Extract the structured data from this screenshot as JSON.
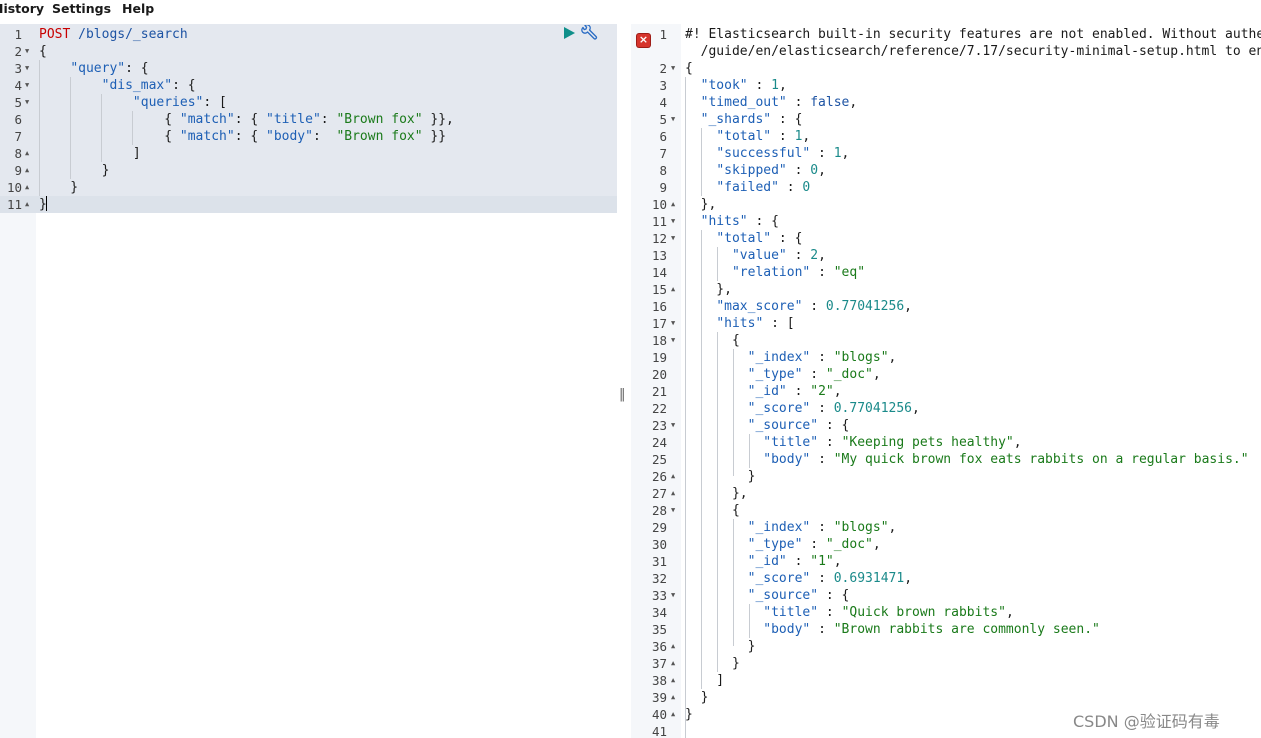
{
  "menu": {
    "history_label": "History",
    "settings_label": "Settings",
    "help_label": "Help"
  },
  "request_editor": {
    "lines": [
      {
        "n": "1",
        "fold": "",
        "tokens": [
          {
            "t": "POST",
            "c": "method"
          },
          {
            "t": " /blogs/_search",
            "c": "url"
          }
        ]
      },
      {
        "n": "2",
        "fold": "▼",
        "tokens": [
          {
            "t": "{",
            "c": "punc"
          }
        ]
      },
      {
        "n": "3",
        "fold": "▼",
        "tokens": [
          {
            "t": "    ",
            "c": "punc"
          },
          {
            "t": "\"query\"",
            "c": "key"
          },
          {
            "t": ": {",
            "c": "punc"
          }
        ]
      },
      {
        "n": "4",
        "fold": "▼",
        "tokens": [
          {
            "t": "        ",
            "c": "punc"
          },
          {
            "t": "\"dis_max\"",
            "c": "key"
          },
          {
            "t": ": {",
            "c": "punc"
          }
        ]
      },
      {
        "n": "5",
        "fold": "▼",
        "tokens": [
          {
            "t": "            ",
            "c": "punc"
          },
          {
            "t": "\"queries\"",
            "c": "key"
          },
          {
            "t": ": [",
            "c": "punc"
          }
        ]
      },
      {
        "n": "6",
        "fold": "",
        "tokens": [
          {
            "t": "                { ",
            "c": "punc"
          },
          {
            "t": "\"match\"",
            "c": "key"
          },
          {
            "t": ": { ",
            "c": "punc"
          },
          {
            "t": "\"title\"",
            "c": "key"
          },
          {
            "t": ": ",
            "c": "punc"
          },
          {
            "t": "\"Brown fox\"",
            "c": "str"
          },
          {
            "t": " }},",
            "c": "punc"
          }
        ]
      },
      {
        "n": "7",
        "fold": "",
        "tokens": [
          {
            "t": "                { ",
            "c": "punc"
          },
          {
            "t": "\"match\"",
            "c": "key"
          },
          {
            "t": ": { ",
            "c": "punc"
          },
          {
            "t": "\"body\"",
            "c": "key"
          },
          {
            "t": ":  ",
            "c": "punc"
          },
          {
            "t": "\"Brown fox\"",
            "c": "str"
          },
          {
            "t": " }}",
            "c": "punc"
          }
        ]
      },
      {
        "n": "8",
        "fold": "▲",
        "tokens": [
          {
            "t": "            ]",
            "c": "punc"
          }
        ]
      },
      {
        "n": "9",
        "fold": "▲",
        "tokens": [
          {
            "t": "        }",
            "c": "punc"
          }
        ]
      },
      {
        "n": "10",
        "fold": "▲",
        "tokens": [
          {
            "t": "    }",
            "c": "punc"
          }
        ]
      },
      {
        "n": "11",
        "fold": "▲",
        "tokens": [
          {
            "t": "}",
            "c": "punc"
          }
        ]
      }
    ]
  },
  "response_viewer": {
    "error_marker": "×",
    "lines": [
      {
        "n": "1",
        "fold": "",
        "tokens": [
          {
            "t": "#! Elasticsearch built-in security features are not enabled. Without authen",
            "c": "comment"
          }
        ]
      },
      {
        "n": "",
        "fold": "",
        "tokens": [
          {
            "t": "  /guide/en/elasticsearch/reference/7.17/security-minimal-setup.html to ena",
            "c": "comment"
          }
        ]
      },
      {
        "n": "2",
        "fold": "▼",
        "tokens": [
          {
            "t": "{",
            "c": "punc"
          }
        ]
      },
      {
        "n": "3",
        "fold": "",
        "tokens": [
          {
            "t": "  ",
            "c": "punc"
          },
          {
            "t": "\"took\"",
            "c": "key"
          },
          {
            "t": " : ",
            "c": "punc"
          },
          {
            "t": "1",
            "c": "num"
          },
          {
            "t": ",",
            "c": "punc"
          }
        ]
      },
      {
        "n": "4",
        "fold": "",
        "tokens": [
          {
            "t": "  ",
            "c": "punc"
          },
          {
            "t": "\"timed_out\"",
            "c": "key"
          },
          {
            "t": " : ",
            "c": "punc"
          },
          {
            "t": "false",
            "c": "bool"
          },
          {
            "t": ",",
            "c": "punc"
          }
        ]
      },
      {
        "n": "5",
        "fold": "▼",
        "tokens": [
          {
            "t": "  ",
            "c": "punc"
          },
          {
            "t": "\"_shards\"",
            "c": "key"
          },
          {
            "t": " : {",
            "c": "punc"
          }
        ]
      },
      {
        "n": "6",
        "fold": "",
        "tokens": [
          {
            "t": "    ",
            "c": "punc"
          },
          {
            "t": "\"total\"",
            "c": "key"
          },
          {
            "t": " : ",
            "c": "punc"
          },
          {
            "t": "1",
            "c": "num"
          },
          {
            "t": ",",
            "c": "punc"
          }
        ]
      },
      {
        "n": "7",
        "fold": "",
        "tokens": [
          {
            "t": "    ",
            "c": "punc"
          },
          {
            "t": "\"successful\"",
            "c": "key"
          },
          {
            "t": " : ",
            "c": "punc"
          },
          {
            "t": "1",
            "c": "num"
          },
          {
            "t": ",",
            "c": "punc"
          }
        ]
      },
      {
        "n": "8",
        "fold": "",
        "tokens": [
          {
            "t": "    ",
            "c": "punc"
          },
          {
            "t": "\"skipped\"",
            "c": "key"
          },
          {
            "t": " : ",
            "c": "punc"
          },
          {
            "t": "0",
            "c": "num"
          },
          {
            "t": ",",
            "c": "punc"
          }
        ]
      },
      {
        "n": "9",
        "fold": "",
        "tokens": [
          {
            "t": "    ",
            "c": "punc"
          },
          {
            "t": "\"failed\"",
            "c": "key"
          },
          {
            "t": " : ",
            "c": "punc"
          },
          {
            "t": "0",
            "c": "num"
          }
        ]
      },
      {
        "n": "10",
        "fold": "▲",
        "tokens": [
          {
            "t": "  },",
            "c": "punc"
          }
        ]
      },
      {
        "n": "11",
        "fold": "▼",
        "tokens": [
          {
            "t": "  ",
            "c": "punc"
          },
          {
            "t": "\"hits\"",
            "c": "key"
          },
          {
            "t": " : {",
            "c": "punc"
          }
        ]
      },
      {
        "n": "12",
        "fold": "▼",
        "tokens": [
          {
            "t": "    ",
            "c": "punc"
          },
          {
            "t": "\"total\"",
            "c": "key"
          },
          {
            "t": " : {",
            "c": "punc"
          }
        ]
      },
      {
        "n": "13",
        "fold": "",
        "tokens": [
          {
            "t": "      ",
            "c": "punc"
          },
          {
            "t": "\"value\"",
            "c": "key"
          },
          {
            "t": " : ",
            "c": "punc"
          },
          {
            "t": "2",
            "c": "num"
          },
          {
            "t": ",",
            "c": "punc"
          }
        ]
      },
      {
        "n": "14",
        "fold": "",
        "tokens": [
          {
            "t": "      ",
            "c": "punc"
          },
          {
            "t": "\"relation\"",
            "c": "key"
          },
          {
            "t": " : ",
            "c": "punc"
          },
          {
            "t": "\"eq\"",
            "c": "str"
          }
        ]
      },
      {
        "n": "15",
        "fold": "▲",
        "tokens": [
          {
            "t": "    },",
            "c": "punc"
          }
        ]
      },
      {
        "n": "16",
        "fold": "",
        "tokens": [
          {
            "t": "    ",
            "c": "punc"
          },
          {
            "t": "\"max_score\"",
            "c": "key"
          },
          {
            "t": " : ",
            "c": "punc"
          },
          {
            "t": "0.77041256",
            "c": "num"
          },
          {
            "t": ",",
            "c": "punc"
          }
        ]
      },
      {
        "n": "17",
        "fold": "▼",
        "tokens": [
          {
            "t": "    ",
            "c": "punc"
          },
          {
            "t": "\"hits\"",
            "c": "key"
          },
          {
            "t": " : [",
            "c": "punc"
          }
        ]
      },
      {
        "n": "18",
        "fold": "▼",
        "tokens": [
          {
            "t": "      {",
            "c": "punc"
          }
        ]
      },
      {
        "n": "19",
        "fold": "",
        "tokens": [
          {
            "t": "        ",
            "c": "punc"
          },
          {
            "t": "\"_index\"",
            "c": "key"
          },
          {
            "t": " : ",
            "c": "punc"
          },
          {
            "t": "\"blogs\"",
            "c": "str"
          },
          {
            "t": ",",
            "c": "punc"
          }
        ]
      },
      {
        "n": "20",
        "fold": "",
        "tokens": [
          {
            "t": "        ",
            "c": "punc"
          },
          {
            "t": "\"_type\"",
            "c": "key"
          },
          {
            "t": " : ",
            "c": "punc"
          },
          {
            "t": "\"_doc\"",
            "c": "str"
          },
          {
            "t": ",",
            "c": "punc"
          }
        ]
      },
      {
        "n": "21",
        "fold": "",
        "tokens": [
          {
            "t": "        ",
            "c": "punc"
          },
          {
            "t": "\"_id\"",
            "c": "key"
          },
          {
            "t": " : ",
            "c": "punc"
          },
          {
            "t": "\"2\"",
            "c": "str"
          },
          {
            "t": ",",
            "c": "punc"
          }
        ]
      },
      {
        "n": "22",
        "fold": "",
        "tokens": [
          {
            "t": "        ",
            "c": "punc"
          },
          {
            "t": "\"_score\"",
            "c": "key"
          },
          {
            "t": " : ",
            "c": "punc"
          },
          {
            "t": "0.77041256",
            "c": "num"
          },
          {
            "t": ",",
            "c": "punc"
          }
        ]
      },
      {
        "n": "23",
        "fold": "▼",
        "tokens": [
          {
            "t": "        ",
            "c": "punc"
          },
          {
            "t": "\"_source\"",
            "c": "key"
          },
          {
            "t": " : {",
            "c": "punc"
          }
        ]
      },
      {
        "n": "24",
        "fold": "",
        "tokens": [
          {
            "t": "          ",
            "c": "punc"
          },
          {
            "t": "\"title\"",
            "c": "key"
          },
          {
            "t": " : ",
            "c": "punc"
          },
          {
            "t": "\"Keeping pets healthy\"",
            "c": "str"
          },
          {
            "t": ",",
            "c": "punc"
          }
        ]
      },
      {
        "n": "25",
        "fold": "",
        "tokens": [
          {
            "t": "          ",
            "c": "punc"
          },
          {
            "t": "\"body\"",
            "c": "key"
          },
          {
            "t": " : ",
            "c": "punc"
          },
          {
            "t": "\"My quick brown fox eats rabbits on a regular basis.\"",
            "c": "str"
          }
        ]
      },
      {
        "n": "26",
        "fold": "▲",
        "tokens": [
          {
            "t": "        }",
            "c": "punc"
          }
        ]
      },
      {
        "n": "27",
        "fold": "▲",
        "tokens": [
          {
            "t": "      },",
            "c": "punc"
          }
        ]
      },
      {
        "n": "28",
        "fold": "▼",
        "tokens": [
          {
            "t": "      {",
            "c": "punc"
          }
        ]
      },
      {
        "n": "29",
        "fold": "",
        "tokens": [
          {
            "t": "        ",
            "c": "punc"
          },
          {
            "t": "\"_index\"",
            "c": "key"
          },
          {
            "t": " : ",
            "c": "punc"
          },
          {
            "t": "\"blogs\"",
            "c": "str"
          },
          {
            "t": ",",
            "c": "punc"
          }
        ]
      },
      {
        "n": "30",
        "fold": "",
        "tokens": [
          {
            "t": "        ",
            "c": "punc"
          },
          {
            "t": "\"_type\"",
            "c": "key"
          },
          {
            "t": " : ",
            "c": "punc"
          },
          {
            "t": "\"_doc\"",
            "c": "str"
          },
          {
            "t": ",",
            "c": "punc"
          }
        ]
      },
      {
        "n": "31",
        "fold": "",
        "tokens": [
          {
            "t": "        ",
            "c": "punc"
          },
          {
            "t": "\"_id\"",
            "c": "key"
          },
          {
            "t": " : ",
            "c": "punc"
          },
          {
            "t": "\"1\"",
            "c": "str"
          },
          {
            "t": ",",
            "c": "punc"
          }
        ]
      },
      {
        "n": "32",
        "fold": "",
        "tokens": [
          {
            "t": "        ",
            "c": "punc"
          },
          {
            "t": "\"_score\"",
            "c": "key"
          },
          {
            "t": " : ",
            "c": "punc"
          },
          {
            "t": "0.6931471",
            "c": "num"
          },
          {
            "t": ",",
            "c": "punc"
          }
        ]
      },
      {
        "n": "33",
        "fold": "▼",
        "tokens": [
          {
            "t": "        ",
            "c": "punc"
          },
          {
            "t": "\"_source\"",
            "c": "key"
          },
          {
            "t": " : {",
            "c": "punc"
          }
        ]
      },
      {
        "n": "34",
        "fold": "",
        "tokens": [
          {
            "t": "          ",
            "c": "punc"
          },
          {
            "t": "\"title\"",
            "c": "key"
          },
          {
            "t": " : ",
            "c": "punc"
          },
          {
            "t": "\"Quick brown rabbits\"",
            "c": "str"
          },
          {
            "t": ",",
            "c": "punc"
          }
        ]
      },
      {
        "n": "35",
        "fold": "",
        "tokens": [
          {
            "t": "          ",
            "c": "punc"
          },
          {
            "t": "\"body\"",
            "c": "key"
          },
          {
            "t": " : ",
            "c": "punc"
          },
          {
            "t": "\"Brown rabbits are commonly seen.\"",
            "c": "str"
          }
        ]
      },
      {
        "n": "36",
        "fold": "▲",
        "tokens": [
          {
            "t": "        }",
            "c": "punc"
          }
        ]
      },
      {
        "n": "37",
        "fold": "▲",
        "tokens": [
          {
            "t": "      }",
            "c": "punc"
          }
        ]
      },
      {
        "n": "38",
        "fold": "▲",
        "tokens": [
          {
            "t": "    ]",
            "c": "punc"
          }
        ]
      },
      {
        "n": "39",
        "fold": "▲",
        "tokens": [
          {
            "t": "  }",
            "c": "punc"
          }
        ]
      },
      {
        "n": "40",
        "fold": "▲",
        "tokens": [
          {
            "t": "}",
            "c": "punc"
          }
        ]
      },
      {
        "n": "41",
        "fold": "",
        "tokens": []
      }
    ]
  },
  "watermark": "CSDN @验证码有毒",
  "colors": {
    "method": "#c80000",
    "url": "#1d53a3",
    "key": "#1d5fb5",
    "string": "#1a7a1a",
    "number": "#1a8a8a",
    "run": "#0f8f8a",
    "wrench": "#2a6cc4",
    "error": "#d6342c"
  }
}
